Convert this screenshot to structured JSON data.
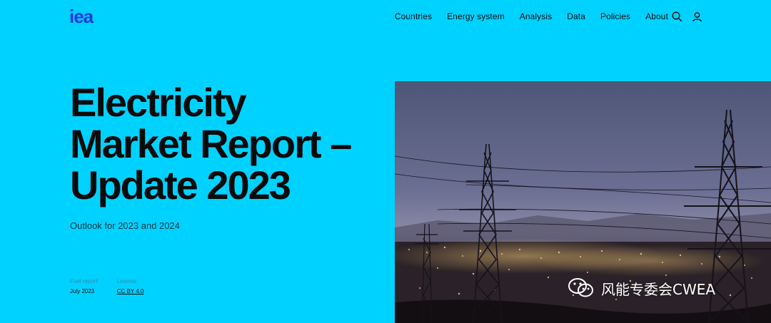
{
  "header": {
    "logo_text": "iea",
    "nav": [
      "Countries",
      "Energy system",
      "Analysis",
      "Data",
      "Policies",
      "About"
    ],
    "icons": [
      "search-icon",
      "user-icon"
    ]
  },
  "hero": {
    "title_lines": [
      "Electricity",
      "Market Report –",
      "Update 2023"
    ],
    "subtitle": "Outlook for 2023 and 2024",
    "meta": [
      {
        "label": "Fuel report",
        "value": "July 2023"
      },
      {
        "label": "License",
        "value": "CC BY 4.0"
      }
    ]
  },
  "watermark": {
    "text": "风能专委会CWEA"
  },
  "colors": {
    "background": "#00D2FF",
    "text": "#0B0B0B",
    "logo": "#1A3BEA"
  }
}
